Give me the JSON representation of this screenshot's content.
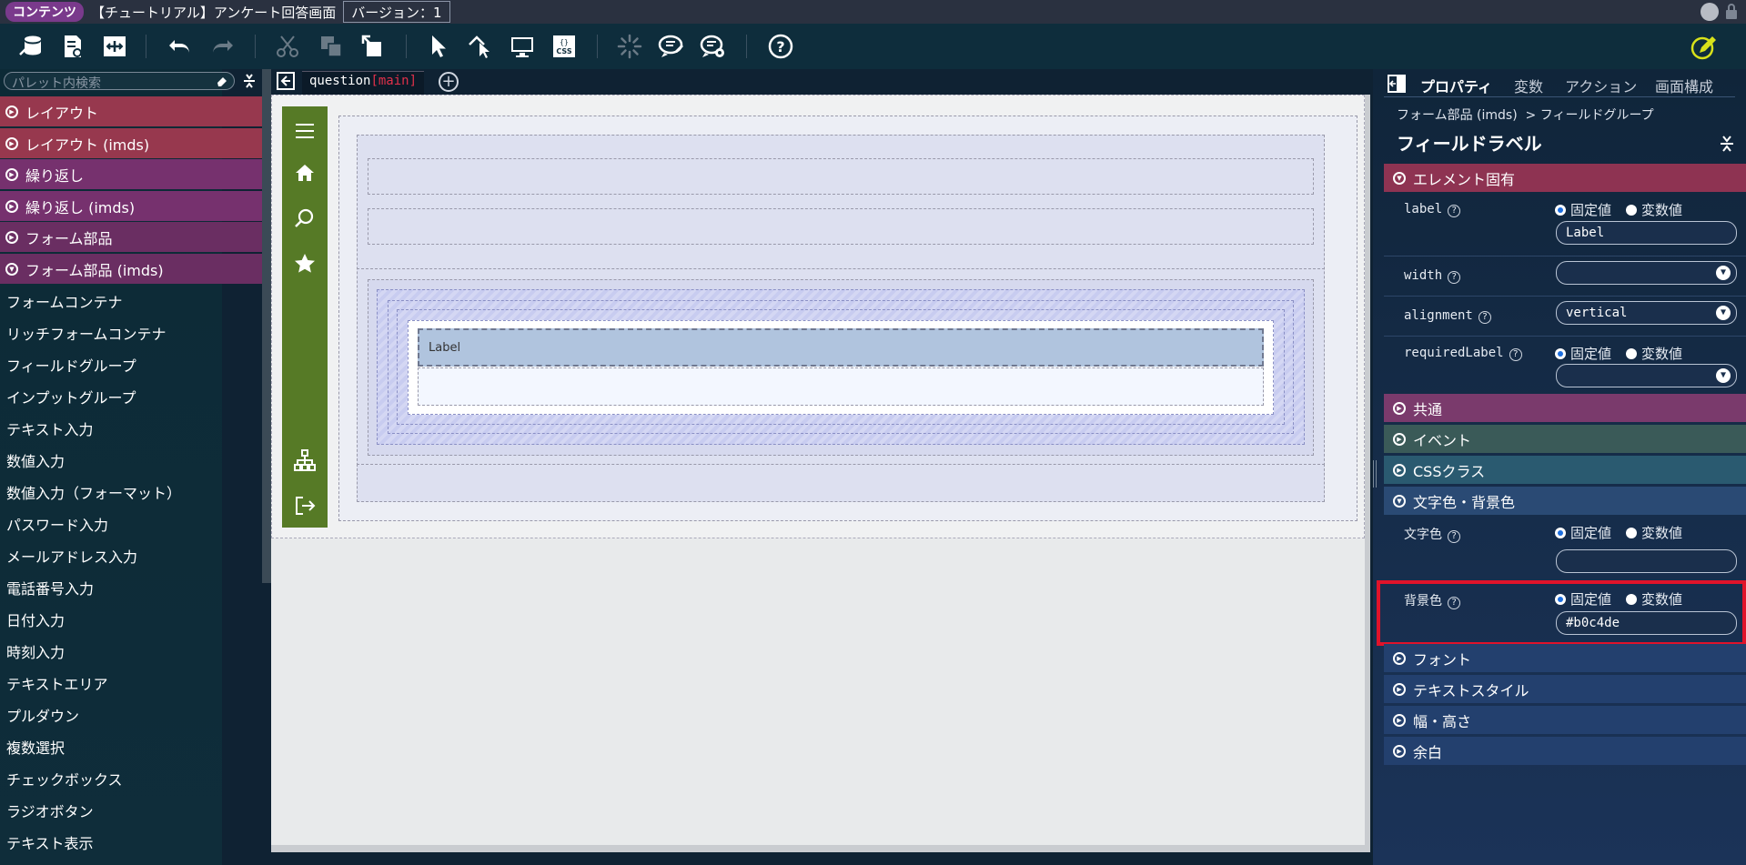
{
  "titlebar": {
    "badge": "コンテンツ",
    "title": "【チュートリアル】アンケート回答画面",
    "version": "バージョン：1"
  },
  "palette": {
    "search_placeholder": "パレット内検索",
    "categories": [
      "レイアウト",
      "レイアウト (imds)",
      "繰り返し",
      "繰り返し (imds)",
      "フォーム部品",
      "フォーム部品 (imds)"
    ],
    "items": [
      "フォームコンテナ",
      "リッチフォームコンテナ",
      "フィールドグループ",
      "インプットグループ",
      "テキスト入力",
      "数値入力",
      "数値入力（フォーマット）",
      "パスワード入力",
      "メールアドレス入力",
      "電話番号入力",
      "日付入力",
      "時刻入力",
      "テキストエリア",
      "プルダウン",
      "複数選択",
      "チェックボックス",
      "ラジオボタン",
      "テキスト表示"
    ]
  },
  "tabs": {
    "name": "question",
    "tag": "[main]"
  },
  "canvas": {
    "field_label": "Label"
  },
  "props": {
    "tabs": [
      "プロパティ",
      "変数",
      "アクション",
      "画面構成"
    ],
    "breadcrumb": "フォーム部品 (imds)  > フィールドグループ",
    "title": "フィールドラベル",
    "sections": {
      "element": "エレメント固有",
      "common": "共通",
      "event": "イベント",
      "css": "CSSクラス",
      "color": "文字色・背景色",
      "font": "フォント",
      "textstyle": "テキストスタイル",
      "size": "幅・高さ",
      "margin": "余白"
    },
    "radio_fixed": "固定値",
    "radio_var": "変数値",
    "rows": {
      "label": {
        "name": "label",
        "value": "Label"
      },
      "width": {
        "name": "width",
        "value": ""
      },
      "alignment": {
        "name": "alignment",
        "value": "vertical"
      },
      "requiredLabel": {
        "name": "requiredLabel",
        "value": ""
      },
      "textcolor": {
        "name": "文字色",
        "value": ""
      },
      "bgcolor": {
        "name": "背景色",
        "value": "#b0c4de"
      }
    }
  },
  "colors": {
    "highlight": "#e0132a",
    "bg_value": "#b0c4de",
    "nav_green": "#567a26"
  }
}
